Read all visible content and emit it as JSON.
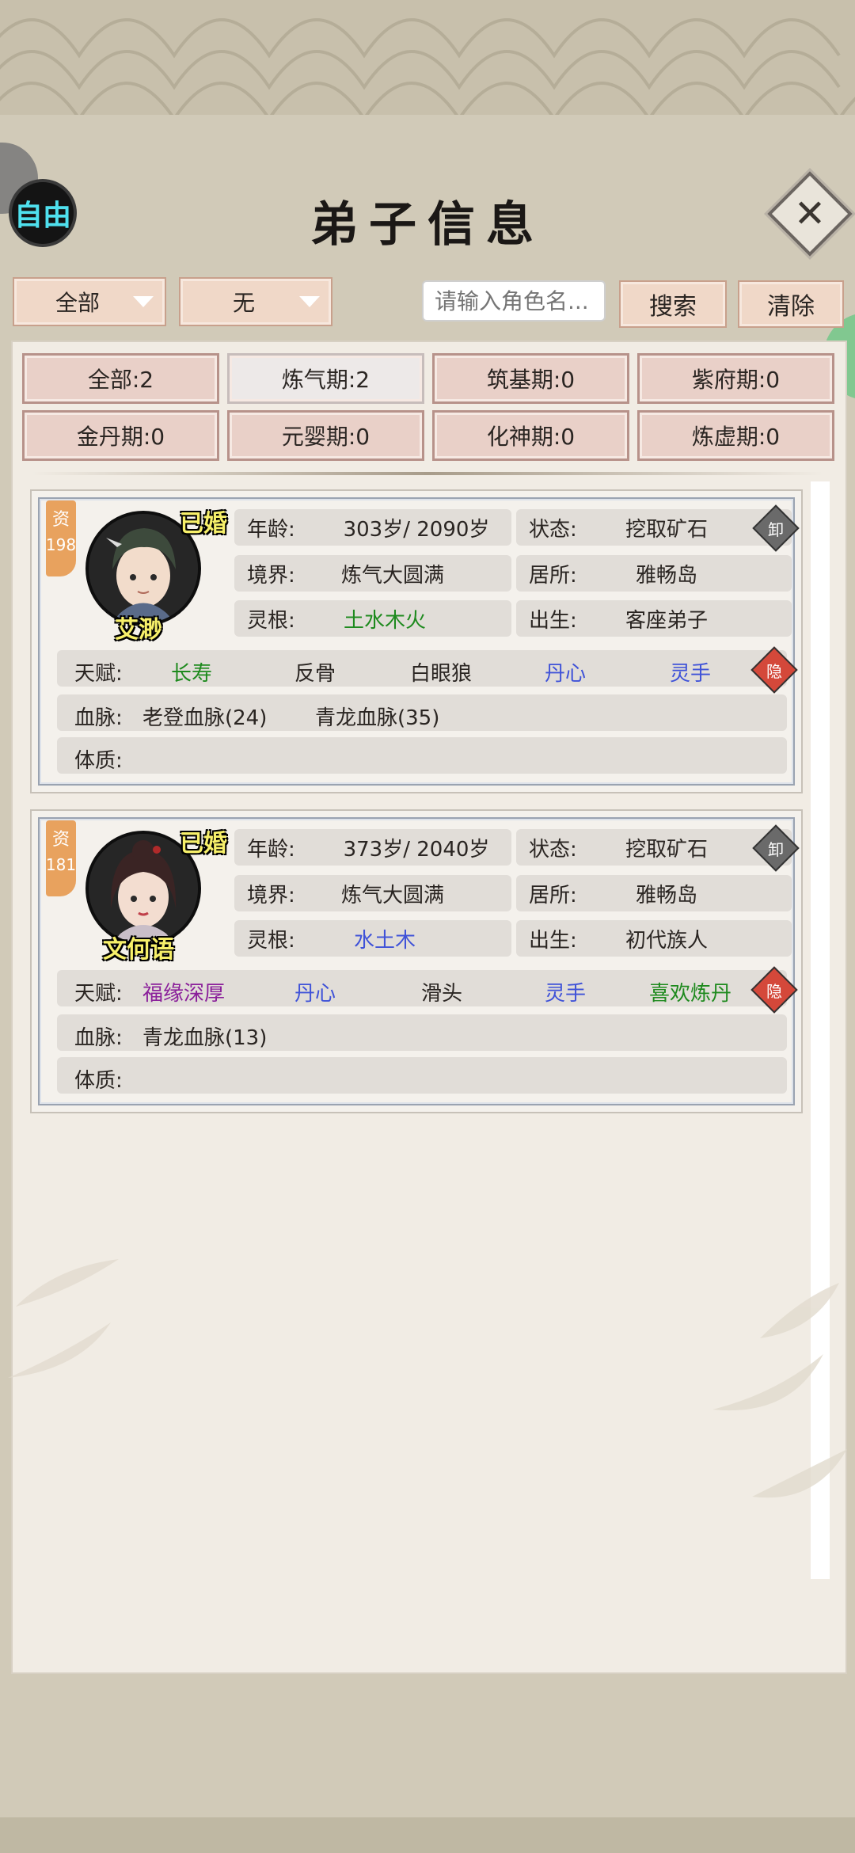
{
  "header": {
    "title": "弟子信息",
    "free_label": "自由",
    "close_icon": "close-icon"
  },
  "toolbar": {
    "dropdown1": "全部",
    "dropdown2": "无",
    "search_placeholder": "请输入角色名...",
    "search_label": "搜索",
    "clear_label": "清除"
  },
  "filters": [
    {
      "label": "全部:2",
      "active": false
    },
    {
      "label": "炼气期:2",
      "active": true
    },
    {
      "label": "筑基期:0",
      "active": false
    },
    {
      "label": "紫府期:0",
      "active": false
    },
    {
      "label": "金丹期:0",
      "active": false
    },
    {
      "label": "元婴期:0",
      "active": false
    },
    {
      "label": "化神期:0",
      "active": false
    },
    {
      "label": "炼虚期:0",
      "active": false
    }
  ],
  "disciples": [
    {
      "talent_label": "资",
      "talent_value": "198",
      "marital": "已婚",
      "name": "艾渺",
      "age_key": "年龄:",
      "age_value": "303岁/ 2090岁",
      "state_key": "状态:",
      "state_value": "挖取矿石",
      "realm_key": "境界:",
      "realm_value": "炼气大圆满",
      "home_key": "居所:",
      "home_value": "雅畅岛",
      "root_key": "灵根:",
      "root_value": "土水木火",
      "origin_key": "出生:",
      "origin_value": "客座弟子",
      "unload_label": "卸",
      "hide_label": "隐",
      "gift_key": "天赋:",
      "gifts": [
        "长寿",
        "反骨",
        "白眼狼",
        "丹心",
        "灵手"
      ],
      "blood_key": "血脉:",
      "bloodlines": [
        "老登血脉(24)",
        "青龙血脉(35)"
      ],
      "body_key": "体质:"
    },
    {
      "talent_label": "资",
      "talent_value": "181",
      "marital": "已婚",
      "name": "文何语",
      "age_key": "年龄:",
      "age_value": "373岁/ 2040岁",
      "state_key": "状态:",
      "state_value": "挖取矿石",
      "realm_key": "境界:",
      "realm_value": "炼气大圆满",
      "home_key": "居所:",
      "home_value": "雅畅岛",
      "root_key": "灵根:",
      "root_value": "水土木",
      "origin_key": "出生:",
      "origin_value": "初代族人",
      "unload_label": "卸",
      "hide_label": "隐",
      "gift_key": "天赋:",
      "gifts": [
        "福缘深厚",
        "丹心",
        "滑头",
        "灵手",
        "喜欢炼丹"
      ],
      "blood_key": "血脉:",
      "bloodlines": [
        "青龙血脉(13)"
      ],
      "body_key": "体质:"
    }
  ],
  "colors": {
    "green": "#1e8a1e",
    "blue": "#3f52d8",
    "purple": "#8a1f9a",
    "married": "#f7f06a",
    "free": "#4fe0ee"
  }
}
